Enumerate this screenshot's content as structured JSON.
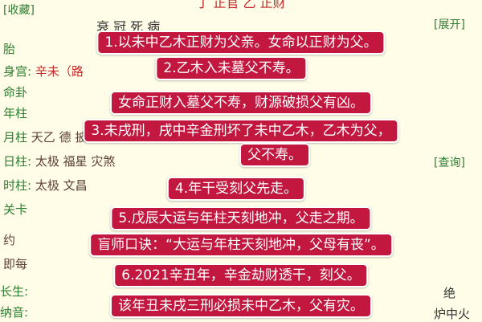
{
  "background": {
    "collect_button": "[收藏]",
    "expand_button": "[展开]",
    "query_button": "[查询]",
    "top_partial": "丁  正官      乙  正财",
    "header_row": "衰        冠        死        病",
    "rows": [
      {
        "label": "胎",
        "value": ""
      },
      {
        "label": "身宫:",
        "value": "辛未（路"
      },
      {
        "label": "命卦",
        "value": ""
      },
      {
        "label": "年柱",
        "value": ""
      },
      {
        "label": "月柱",
        "value": "天乙  德  披麻  "
      },
      {
        "label": "日柱:",
        "value": "太极  福星  灾煞"
      },
      {
        "label": "时柱:",
        "value": "太极  文昌"
      },
      {
        "label": "关卡",
        "value": ""
      },
      {
        "label": "约",
        "value": ""
      },
      {
        "label": "即每",
        "value": ""
      },
      {
        "label": "长生:",
        "value": ""
      },
      {
        "label": "纳音:",
        "value": ""
      }
    ],
    "bottom_right_1": "绝",
    "bottom_right_2": "炉中火"
  },
  "overlays": [
    "1.以未中乙木正财为父亲。女命以正财为父。",
    "2.乙木入未墓父不寿。",
    "女命正财入墓父不寿，财源破损父有凶。",
    "3.未戌刑，戌中辛金刑坏了未中乙木，乙木为父，",
    "父不寿。",
    "4.年干受刻父先走。",
    "5.戊辰大运与年柱天刻地冲，父走之期。",
    "盲师口诀：“大运与年柱天刻地冲，父母有丧”。",
    "6.2021辛丑年，辛金劫财透干，刻父。",
    "该年丑未戌三刑必损未中乙木，父有灾。"
  ],
  "colors": {
    "overlay_bg": "#C2183F",
    "overlay_text": "#FFFFFF",
    "page_bg": "#FFFDE7",
    "label_green": "#2E7D32",
    "value_red": "#C62828"
  }
}
